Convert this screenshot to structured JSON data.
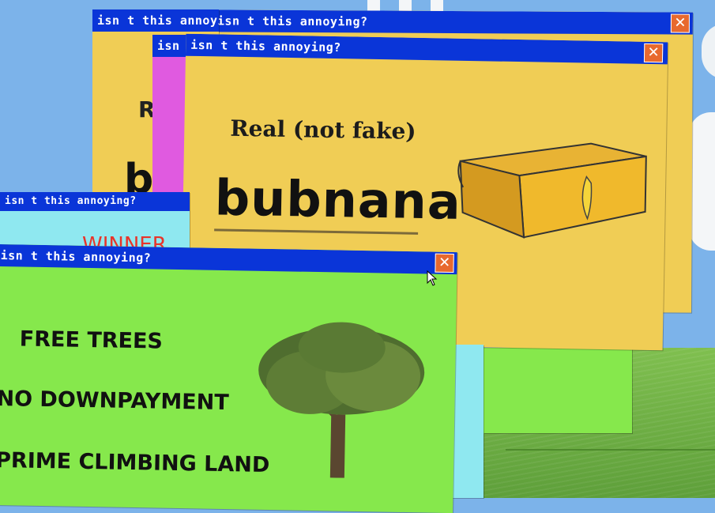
{
  "popup_title": "isn t this annoying?",
  "close_glyph": "✕",
  "bubnana_ad": {
    "tagline": "Real (not fake)",
    "product": "bubnana"
  },
  "tree_ad": {
    "line1": "FREE TREES",
    "line2": "NO DOWNPAYMENT",
    "line3": "PRIME CLIMBING LAND"
  },
  "winner_ad": {
    "headline": "WINNER"
  },
  "colors": {
    "titlebar": "#0a35d8",
    "close_button": "#e8692e",
    "yellow_popup": "#f0cd55",
    "green_popup": "#86e84c",
    "magenta_popup": "#e05ae0",
    "winner_text": "#e8342a"
  }
}
